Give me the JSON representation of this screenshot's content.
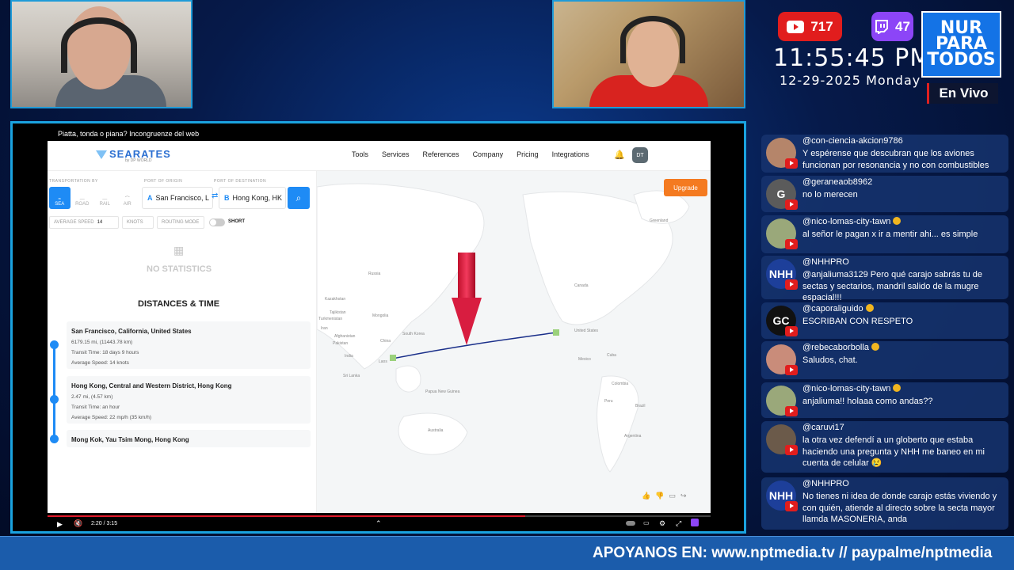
{
  "stats": {
    "youtube_viewers": "717",
    "twitch_viewers": "47"
  },
  "clock": {
    "time": "11:55:45 PM",
    "date": "12-29-2025 Monday"
  },
  "logo": {
    "line1": "NUR",
    "line2": "PARA",
    "line3": "TODOS"
  },
  "live_label": "En Vivo",
  "video": {
    "title": "Piatta, tonda o piana? Incongruenze del web",
    "time": "2:20 / 3:15",
    "progress_fraction": 0.72
  },
  "site": {
    "brand": "SEARATES",
    "brand_sub": "by DP WORLD",
    "nav": [
      "Tools",
      "Services",
      "References",
      "Company",
      "Pricing",
      "Integrations"
    ],
    "avatar": "DT",
    "labels": {
      "transport": "TRANSPORTATION BY",
      "origin_label": "PORT OF ORIGIN",
      "dest_label": "PORT OF DESTINATION"
    },
    "modes": [
      "SEA",
      "ROAD",
      "RAIL",
      "AIR"
    ],
    "origin": "San Francisco, L",
    "destination": "Hong Kong, HK",
    "average_speed_label": "AVERAGE SPEED",
    "average_speed_value": "14",
    "knots_label": "KNOTS",
    "routing_label": "ROUTING MODE",
    "short_label": "SHORT",
    "no_stats": "NO STATISTICS",
    "distances_title": "DISTANCES & TIME",
    "legs": [
      {
        "title": "San Francisco, California, United States",
        "l1": "6179.15 mi, (11443.78 km)",
        "l2": "Transit Time: 18 days 9 hours",
        "l3": "Average Speed: 14 knots"
      },
      {
        "title": "Hong Kong, Central and Western District, Hong Kong",
        "l1": "2.47 mi, (4.57 km)",
        "l2": "Transit Time: an hour",
        "l3": "Average Speed: 22 mp/h (35 km/h)"
      },
      {
        "title": "Mong Kok, Yau Tsim Mong, Hong Kong"
      }
    ],
    "upgrade": "Upgrade",
    "map_labels": [
      "Greenland",
      "Russia",
      "Mongolia",
      "China",
      "South Korea",
      "Kazakhstan",
      "Pakistan",
      "India",
      "Sri Lanka",
      "Laos",
      "Papua New Guinea",
      "Australia",
      "United States",
      "Canada",
      "Mexico",
      "Cuba",
      "Colombia",
      "Peru",
      "Brazil",
      "Argentina",
      "Afghanistan",
      "Tajikistan",
      "Iran",
      "Turkmenistan"
    ]
  },
  "chat": [
    {
      "name": "@con-ciencia-akcion9786",
      "text": "Y espérense que descubran que los aviones funcionan por resonancia y no con combustibles",
      "avatar": "photo"
    },
    {
      "name": "@geraneaob8962",
      "text": "no lo merecen",
      "avatar": "G"
    },
    {
      "name": "@nico-lomas-city-tawn",
      "text": "al señor le pagan x ir a mentir ahi... es simple",
      "avatar": "photo",
      "member": true
    },
    {
      "name": "@NHHPRO",
      "text": "@anjaliuma3129 Pero qué carajo sabrás tu de sectas y sectarios, mandril salido de la mugre espacial!!!",
      "avatar": "NHH"
    },
    {
      "name": "@caporaliguido",
      "text": "ESCRIBAN CON RESPETO",
      "avatar": "GC",
      "member": true
    },
    {
      "name": "@rebecaborbolla",
      "text": "Saludos, chat.",
      "avatar": "photo",
      "member": true
    },
    {
      "name": "@nico-lomas-city-tawn",
      "text": "anjaliuma!! holaaa como andas??",
      "avatar": "photo",
      "member": true
    },
    {
      "name": "@caruvi17",
      "text": "la otra vez defendí a un globerto que estaba haciendo una pregunta y NHH me baneo en mi cuenta de celular 😢",
      "avatar": "photo"
    },
    {
      "name": "@NHHPRO",
      "text": "No tienes ni idea de donde carajo estás viviendo y con quién, atiende al directo sobre la secta mayor llamda MASONERIA, anda",
      "avatar": "NHH"
    }
  ],
  "ticker": "APOYANOS EN: www.nptmedia.tv // paypalme/nptmedia"
}
